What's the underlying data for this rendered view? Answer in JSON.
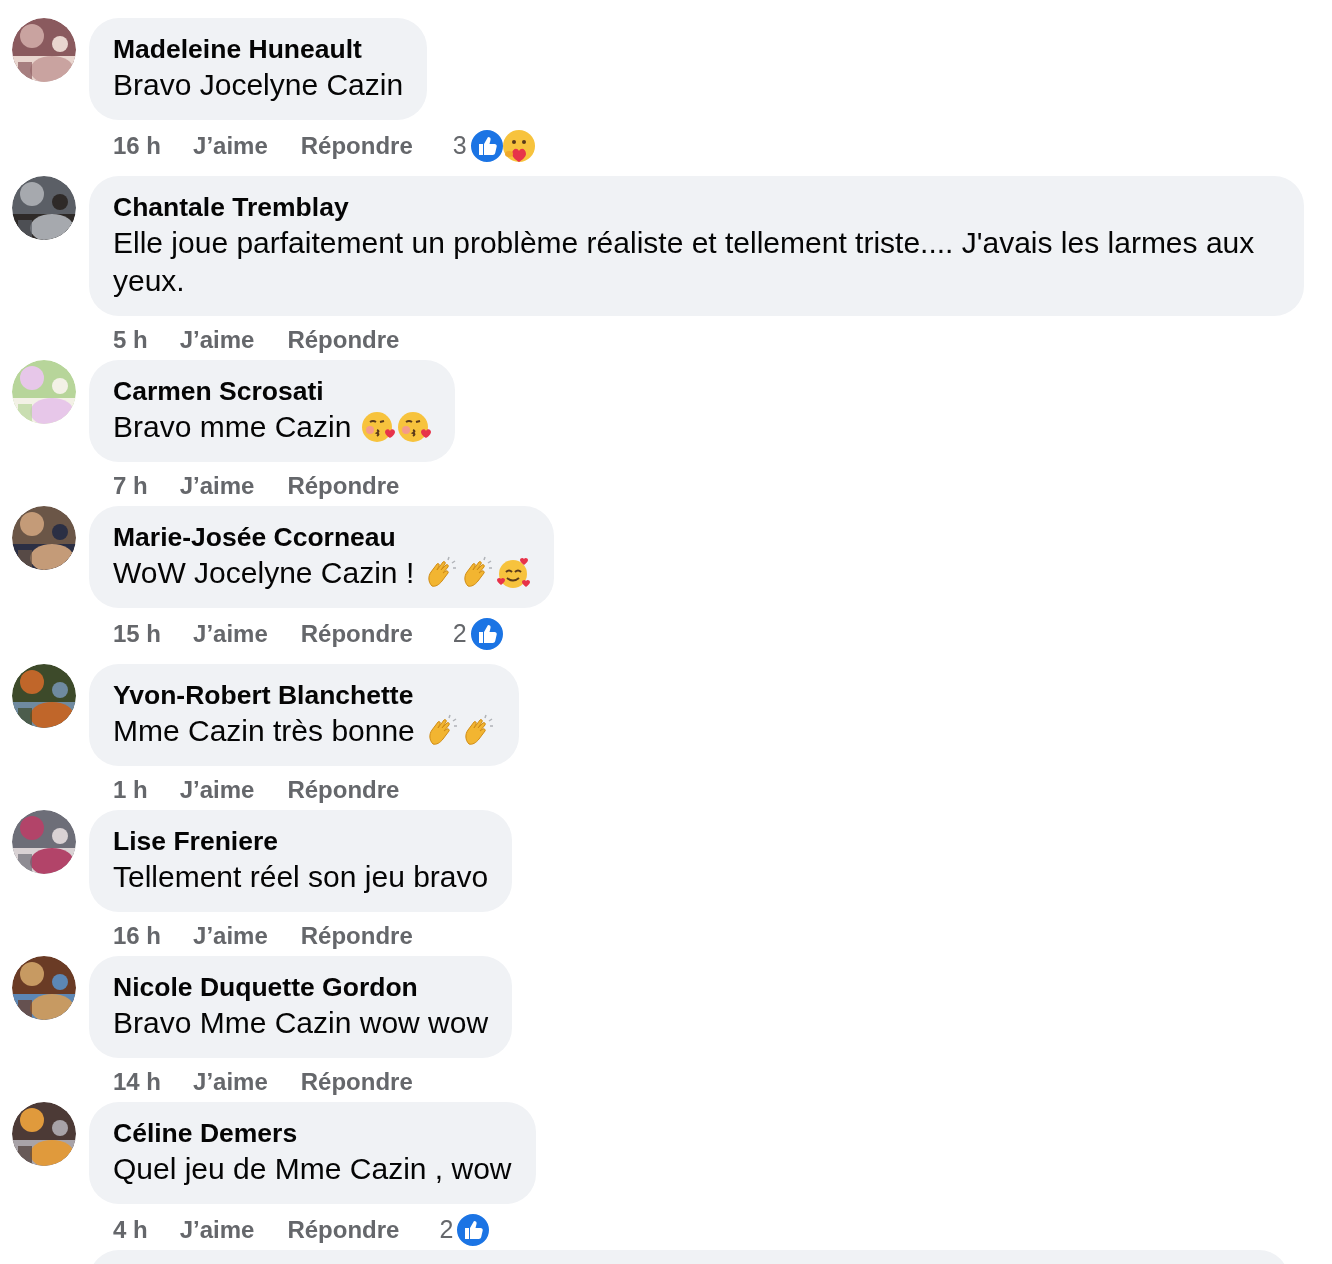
{
  "comments": [
    {
      "author": "Madeleine Huneault",
      "text": "Bravo Jocelyne Cazin",
      "time": "16 h",
      "like": "J’aime",
      "reply": "Répondre",
      "reactions": {
        "count": "3",
        "icons": [
          {
            "kind": "like"
          },
          {
            "kind": "care"
          }
        ]
      }
    },
    {
      "author": "Chantale Tremblay",
      "text": "Elle joue parfaitement un problème réaliste et tellement triste.... J'avais les larmes aux yeux.",
      "time": "5 h",
      "like": "J’aime",
      "reply": "Répondre"
    },
    {
      "author": "Carmen Scrosati",
      "text": "Bravo mme Cazin",
      "emojis": [
        {
          "kind": "kiss"
        },
        {
          "kind": "kiss"
        }
      ],
      "time": "7 h",
      "like": "J’aime",
      "reply": "Répondre"
    },
    {
      "author": "Marie-Josée Ccorneau",
      "text": "WoW Jocelyne Cazin !",
      "emojis": [
        {
          "kind": "clap"
        },
        {
          "kind": "clap"
        },
        {
          "kind": "hearts"
        }
      ],
      "time": "15 h",
      "like": "J’aime",
      "reply": "Répondre",
      "reactions": {
        "count": "2",
        "icons": [
          {
            "kind": "like"
          }
        ]
      }
    },
    {
      "author": "Yvon-Robert Blanchette",
      "text": "Mme Cazin très bonne",
      "emojis": [
        {
          "kind": "clap"
        },
        {
          "kind": "clap"
        }
      ],
      "time": "1 h",
      "like": "J’aime",
      "reply": "Répondre"
    },
    {
      "author": "Lise Freniere",
      "text": "Tellement réel son jeu bravo",
      "time": "16 h",
      "like": "J’aime",
      "reply": "Répondre"
    },
    {
      "author": "Nicole Duquette Gordon",
      "text": "Bravo Mme Cazin wow wow",
      "time": "14 h",
      "like": "J’aime",
      "reply": "Répondre"
    },
    {
      "author": "Céline Demers",
      "text": "Quel jeu de Mme Cazin , wow",
      "time": "4 h",
      "like": "J’aime",
      "reply": "Répondre",
      "reactions": {
        "count": "2",
        "icons": [
          {
            "kind": "like"
          }
        ]
      }
    }
  ]
}
